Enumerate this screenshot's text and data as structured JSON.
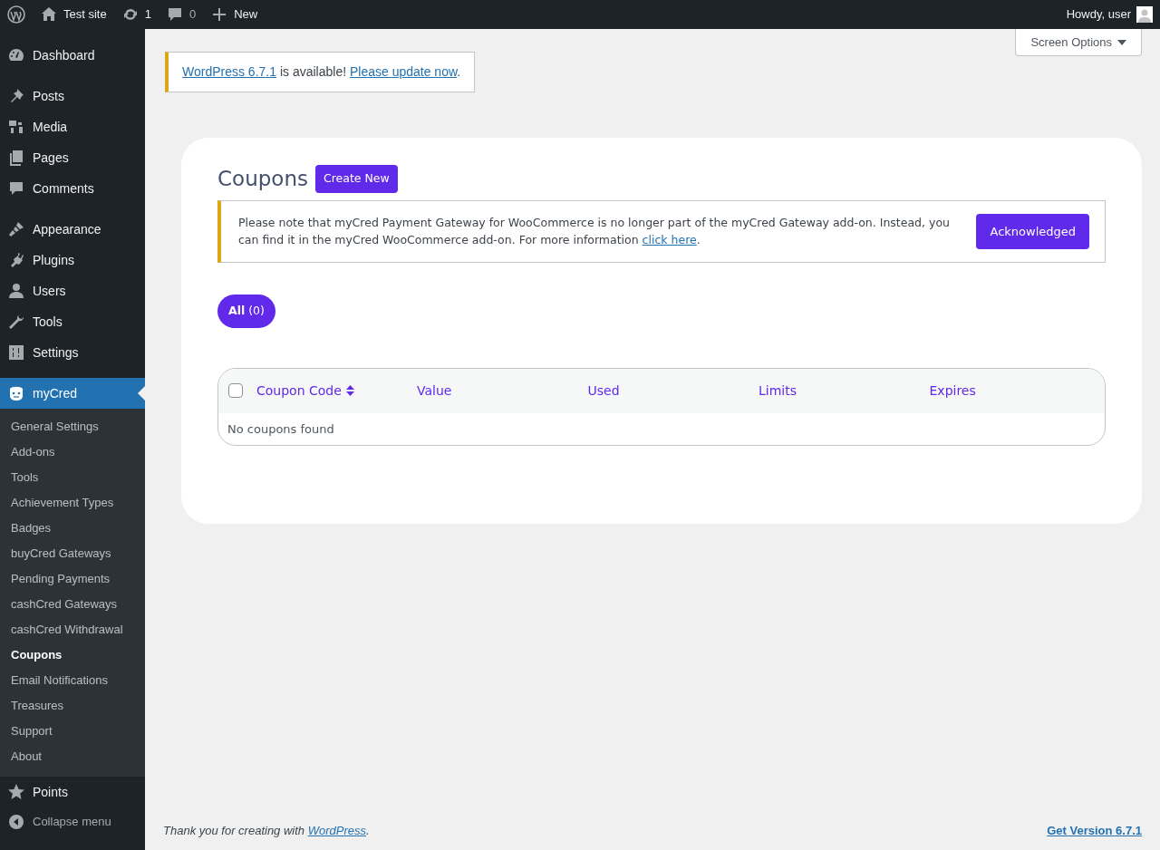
{
  "admin_bar": {
    "site_name": "Test site",
    "updates": "1",
    "comments": "0",
    "new_label": "New",
    "greeting": "Howdy, user"
  },
  "sidebar": {
    "groups": [
      [
        {
          "label": "Dashboard",
          "selected": false
        }
      ],
      [
        {
          "label": "Posts",
          "selected": false
        },
        {
          "label": "Media",
          "selected": false
        },
        {
          "label": "Pages",
          "selected": false
        },
        {
          "label": "Comments",
          "selected": false
        }
      ],
      [
        {
          "label": "Appearance",
          "selected": false
        },
        {
          "label": "Plugins",
          "selected": false
        },
        {
          "label": "Users",
          "selected": false
        },
        {
          "label": "Tools",
          "selected": false
        },
        {
          "label": "Settings",
          "selected": false
        }
      ],
      [
        {
          "label": "myCred",
          "selected": true,
          "children": [
            {
              "label": "General Settings",
              "selected": false
            },
            {
              "label": "Add-ons",
              "selected": false
            },
            {
              "label": "Tools",
              "selected": false
            },
            {
              "label": "Achievement Types",
              "selected": false
            },
            {
              "label": "Badges",
              "selected": false
            },
            {
              "label": "buyCred Gateways",
              "selected": false
            },
            {
              "label": "Pending Payments",
              "selected": false
            },
            {
              "label": "cashCred Gateways",
              "selected": false
            },
            {
              "label": "cashCred Withdrawal",
              "selected": false
            },
            {
              "label": "Coupons",
              "selected": true
            },
            {
              "label": "Email Notifications",
              "selected": false
            },
            {
              "label": "Treasures",
              "selected": false
            },
            {
              "label": "Support",
              "selected": false
            },
            {
              "label": "About",
              "selected": false
            }
          ]
        },
        {
          "label": "Points",
          "selected": false
        }
      ]
    ],
    "collapse_label": "Collapse menu"
  },
  "screen_options": "Screen Options",
  "update_notice": {
    "version_link": "WordPress 6.7.1",
    "text": "is available!",
    "update_link": "Please update now",
    "end": "."
  },
  "panel": {
    "title": "Coupons",
    "create_button": "Create New",
    "notice": {
      "text": "Please note that myCred Payment Gateway for WooCommerce is no longer part of the myCred Gateway add-on. Instead, you can find it in the myCred WooCommerce add-on. For more information",
      "link": "click here",
      "end": ".",
      "button": "Acknowledged"
    },
    "filters": [
      {
        "label": "All",
        "count": "(0)",
        "selected": true
      }
    ],
    "table": {
      "select_all_checked": false,
      "columns": [
        {
          "label": "Coupon Code",
          "sortable": true
        },
        {
          "label": "Value",
          "sortable": false
        },
        {
          "label": "Used",
          "sortable": false
        },
        {
          "label": "Limits",
          "sortable": false
        },
        {
          "label": "Expires",
          "sortable": false
        }
      ],
      "empty_message": "No coupons found"
    }
  },
  "footer": {
    "text": "Thank you for creating with",
    "link": "WordPress",
    "end": ".",
    "version": "Get Version 6.7.1"
  }
}
